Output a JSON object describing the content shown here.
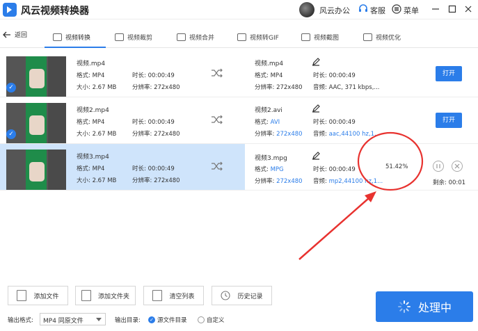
{
  "app": {
    "title": "风云视频转换器",
    "user_name": "风云办公",
    "service_label": "客服",
    "menu_label": "菜单"
  },
  "nav": {
    "back_label": "返回",
    "tabs": [
      {
        "label": "视频转换",
        "icon": "video-convert-icon",
        "active": true
      },
      {
        "label": "视频裁剪",
        "icon": "video-crop-icon"
      },
      {
        "label": "视频合并",
        "icon": "video-merge-icon"
      },
      {
        "label": "视频转GIF",
        "icon": "gif-icon"
      },
      {
        "label": "视频截图",
        "icon": "image-icon"
      },
      {
        "label": "视频优化",
        "icon": "sliders-icon"
      }
    ]
  },
  "files": [
    {
      "src_name": "视频.mp4",
      "src_format": "格式: MP4",
      "src_duration": "时长: 00:00:49",
      "src_size": "大小: 2.67 MB",
      "src_resolution": "分辨率: 272x480",
      "dst_name": "视频.mp4",
      "dst_format_label": "格式: ",
      "dst_format": "MP4",
      "dst_duration": "时长: 00:00:49",
      "dst_resolution_label": "分辨率: ",
      "dst_resolution": "272x480",
      "dst_audio_label": "音频: ",
      "dst_audio": "AAC, 371 kbps,...",
      "action": "打开",
      "checked": true
    },
    {
      "src_name": "视频2.mp4",
      "src_format": "格式: MP4",
      "src_duration": "时长: 00:00:49",
      "src_size": "大小: 2.67 MB",
      "src_resolution": "分辨率: 272x480",
      "dst_name": "视频2.avi",
      "dst_format_label": "格式: ",
      "dst_format": "AVI",
      "dst_duration": "时长: 00:00:49",
      "dst_resolution_label": "分辨率: ",
      "dst_resolution": "272x480",
      "dst_audio_label": "音频: ",
      "dst_audio": "aac,44100 hz,1...",
      "action": "打开",
      "checked": true
    },
    {
      "src_name": "视频3.mp4",
      "src_format": "格式: MP4",
      "src_duration": "时长: 00:00:49",
      "src_size": "大小: 2.67 MB",
      "src_resolution": "分辨率: 272x480",
      "dst_name": "视频3.mpg",
      "dst_format_label": "格式: ",
      "dst_format": "MPG",
      "dst_duration": "时长: 00:00:49",
      "dst_resolution_label": "分辨率: ",
      "dst_resolution": "272x480",
      "dst_audio_label": "音频: ",
      "dst_audio": "mp2,44100 hz,1...",
      "progress": "51.42%",
      "remaining": "剩余: 00:01"
    }
  ],
  "bottom": {
    "add_file": "添加文件",
    "add_folder": "添加文件夹",
    "clear_list": "清空列表",
    "history": "历史记录",
    "process_label": "处理中",
    "output_format_label": "输出格式:",
    "output_format_value": "MP4 同原文件",
    "output_dir_label": "输出目录:",
    "output_dir_source": "源文件目录",
    "output_dir_custom": "自定义"
  },
  "colors": {
    "accent": "#2b7de9",
    "highlight_row": "#cfe4fb",
    "annotation": "#e8322f"
  }
}
